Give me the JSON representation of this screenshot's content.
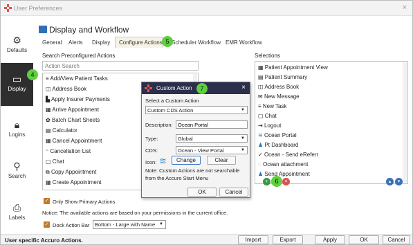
{
  "window": {
    "title": "User Preferences",
    "close": "×"
  },
  "sidebar": {
    "items": [
      {
        "label": "Defaults"
      },
      {
        "label": "Display"
      },
      {
        "label": "Logins"
      },
      {
        "label": "Search"
      },
      {
        "label": "Labels"
      }
    ]
  },
  "header": {
    "title": "Display and Workflow"
  },
  "tabs": [
    "General",
    "Alerts",
    "Display",
    "Configure Actions",
    "Scheduler Workflow",
    "EMR Workflow"
  ],
  "badges": {
    "b4": "4",
    "b5": "5",
    "b6": "6",
    "b7": "7"
  },
  "left": {
    "heading": "Search Preconfigured Actions",
    "search_placeholder": "Action Search",
    "items": [
      "Add/View Patient Tasks",
      "Address Book",
      "Apply Insurer Payments",
      "Arrive Appointment",
      "Batch Chart Sheets",
      "Calculator",
      "Cancel Appointment",
      "Cancellation List",
      "Chat",
      "Copy Appointment",
      "Create Appointment"
    ]
  },
  "right": {
    "heading": "Selections",
    "items": [
      "Patient Appointment View",
      "Patient Summary",
      "Address Book",
      "New Message",
      "New Task",
      "Chat",
      "Logout",
      "Ocean Portal",
      "Pt Dashboard",
      "Ocean - Send eReferr",
      "Ocean attachment",
      "Send Appointment"
    ]
  },
  "dialog": {
    "title": "Custom Action",
    "select_label": "Select a Custom Action",
    "select_value": "Custom CDS Action",
    "description_label": "Description:",
    "description_value": "Ocean Portal",
    "type_label": "Type:",
    "type_value": "Global",
    "cds_label": "CDS:",
    "cds_value": "Ocean - View Portal",
    "icon_label": "Icon:",
    "change": "Change",
    "clear": "Clear",
    "note1": "Note: Custom Actions are not searchable",
    "note2": "from the Accuro Start Menu",
    "ok": "OK",
    "cancel": "Cancel"
  },
  "options": {
    "only_primary": "Only Show Primary Actions",
    "notice": "Notice: The available actions are based on your permissions in the current office.",
    "dock_label": "Dock Action Bar",
    "dock_value": "Bottom - Large with Name"
  },
  "footer": {
    "status": "User specific Accuro Actions.",
    "import": "Import",
    "export": "Export",
    "apply": "Apply",
    "ok": "OK",
    "cancel": "Cancel"
  },
  "colors": {
    "accent": "#c07a2a",
    "badge": "#5fcf3f",
    "dialog_header": "#2b2f4c",
    "sidebar_selected": "#2e2e2e"
  }
}
